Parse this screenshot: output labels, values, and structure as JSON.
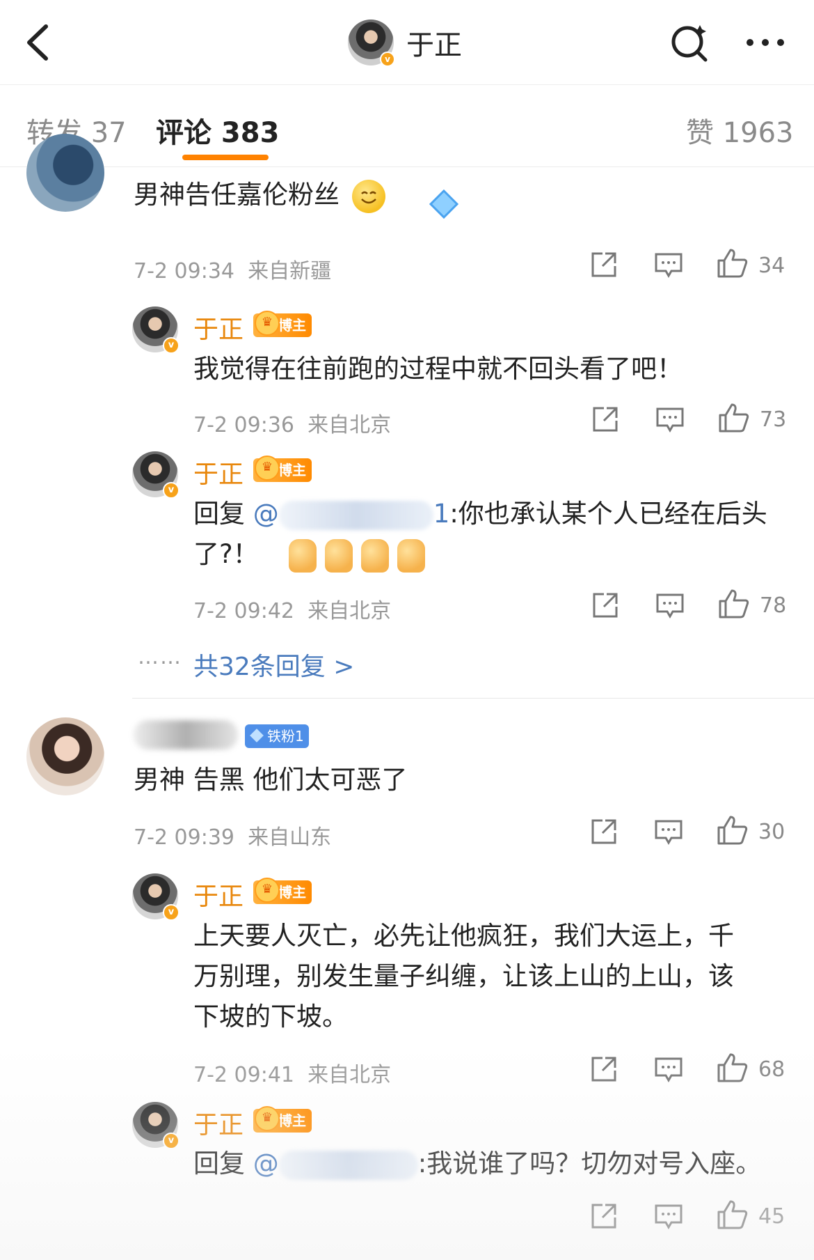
{
  "header": {
    "title": "于正",
    "back_icon": "chevron-left-icon",
    "search_icon": "search-icon",
    "more_icon": "more-icon",
    "verified_mark": "v"
  },
  "tabs": [
    {
      "label": "转发 37",
      "active": false
    },
    {
      "label": "评论 383",
      "active": true
    },
    {
      "label": "赞 1963",
      "active": false
    }
  ],
  "accent_color": "#ff8200",
  "comments": [
    {
      "text": "男神告任嘉伦粉丝",
      "time": "7-2 09:34",
      "location": "来自新疆",
      "likes": "34",
      "replies": [
        {
          "name": "于正",
          "badge": "博主",
          "text": "我觉得在往前跑的过程中就不回头看了吧！",
          "time": "7-2 09:36",
          "location": "来自北京",
          "likes": "73"
        },
        {
          "name": "于正",
          "badge": "博主",
          "text_prefix": "回复",
          "mention_start": "@",
          "mention_end": "1",
          "text": ":你也承认某个人已经在后头",
          "text_line2": "了?！",
          "time": "7-2 09:42",
          "location": "来自北京",
          "likes": "78"
        }
      ],
      "more_dots": "……",
      "more_replies": "共32条回复 >"
    },
    {
      "fan_badge": "铁粉1",
      "text": "男神 告黑 他们太可恶了",
      "time": "7-2 09:39",
      "location": "来自山东",
      "likes": "30",
      "replies": [
        {
          "name": "于正",
          "badge": "博主",
          "text_line1": "上天要人灭亡，必先让他疯狂，我们大运上，千",
          "text_line2": "万别理，别发生量子纠缠，让该上山的上山，该",
          "text_line3": "下坡的下坡。",
          "time": "7-2 09:41",
          "location": "来自北京",
          "likes": "68"
        },
        {
          "name": "于正",
          "badge": "博主",
          "text_prefix": "回复",
          "mention_start": "@",
          "text": ":我说谁了吗？切勿对号入座。",
          "likes": "45"
        }
      ]
    }
  ]
}
